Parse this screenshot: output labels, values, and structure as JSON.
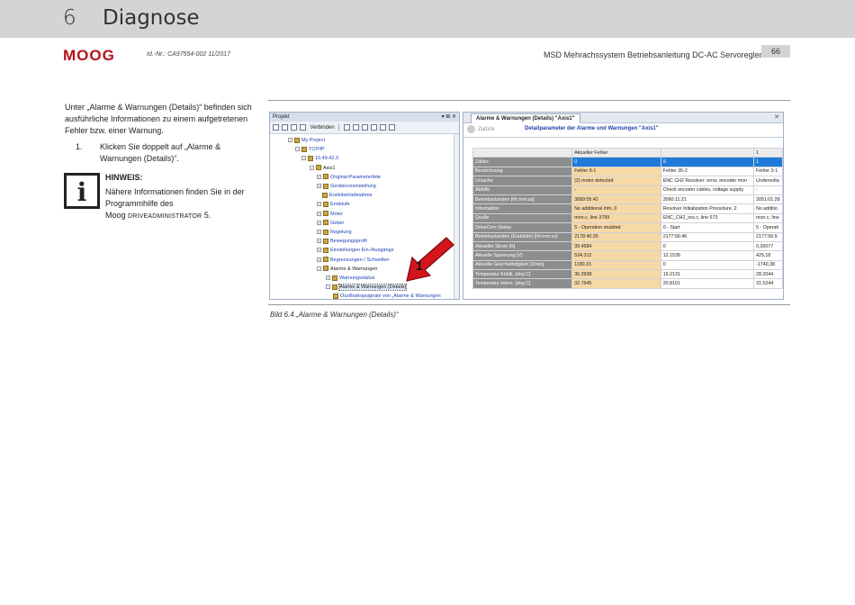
{
  "header": {
    "chapter_number": "6",
    "chapter_title": "Diagnose",
    "logo_text": "MOOG",
    "doc_id": "Id.-Nr.: CA97554-002 11/2017",
    "doc_title": "MSD Mehrachssystem Betriebsanleitung DC-AC Servoregler",
    "page_number": "66"
  },
  "body": {
    "intro": "Unter „Alarme & Warnungen (Details)“ befinden sich ausführliche Informationen zu einem aufgetretenen Fehler bzw. einer Warnung.",
    "step_number": "1.",
    "step_text": "Klicken Sie doppelt auf „Alarme & Warnungen (Details)“.",
    "note_icon": "info-icon",
    "note_glyph": "i",
    "note_heading": "HINWEIS:",
    "note_text": "Nähere Informationen finden Sie in der Programmhilfe des",
    "note_product_prefix": "Moog ",
    "note_product_name": "DriveAdministrator",
    "note_product_suffix": " 5."
  },
  "figure": {
    "caption": "Bild 6.4   „Alarme & Warnungen (Details)“",
    "callout_number": "1",
    "callout_color": "#d4151b",
    "project_panel": {
      "title": "Projekt",
      "pin_controls": "▾ ⊞ ✕",
      "connect_label": "Verbinden",
      "tree": [
        {
          "label": "My Project",
          "exp": "-"
        },
        {
          "label": "TCP/IP",
          "exp": "-"
        },
        {
          "label": "10.49.42.3",
          "exp": "-"
        },
        {
          "label": "Axis1",
          "exp": "-"
        },
        {
          "label": "Original-Parameterliste",
          "exp": "+"
        },
        {
          "label": "Gerätevoreinstellung",
          "exp": "+"
        },
        {
          "label": "Erstinbetriebnahme",
          "exp": ""
        },
        {
          "label": "Endstufe",
          "exp": "+"
        },
        {
          "label": "Motor",
          "exp": "+"
        },
        {
          "label": "Geber",
          "exp": "+"
        },
        {
          "label": "Regelung",
          "exp": "+"
        },
        {
          "label": "Bewegungsprofil",
          "exp": "+"
        },
        {
          "label": "Einstellungen Ein-/Ausgänge",
          "exp": "+"
        },
        {
          "label": "Begrenzungen / Schwellen",
          "exp": "+"
        },
        {
          "label": "Alarme & Warnungen",
          "exp": "-"
        },
        {
          "label": "Warnungsstatus",
          "exp": "+"
        },
        {
          "label": "Alarme & Warnungen (Details)",
          "exp": "-"
        },
        {
          "label": "Oszilloskopsignale von „Alarme & Warnungen",
          "exp": ""
        }
      ]
    },
    "detail_panel": {
      "tab_label": "Alarme & Warnungen (Details) \"Axis1\"",
      "back_label": "Zurück",
      "title": "Detailparameter der Alarme und Warnungen \"Axis1\"",
      "header_row": [
        "",
        "Aktueller Fehler",
        "",
        "1"
      ],
      "rows": [
        [
          "Zähler",
          "0",
          "9",
          "1"
        ],
        [
          "Bezeichnung",
          "Fehler 9-1",
          "Fehler 35-2",
          "Fehler 3-1"
        ],
        [
          "Ursache",
          "(2) motor detected",
          "ENC CH2 Resolver: error, encoder mon",
          "Undervolta"
        ],
        [
          "Abhilfe",
          "-",
          "Check encoder cables, voltage supply.",
          "-"
        ],
        [
          "Betriebsstunden [hh:mm:ss]",
          "3089:05:42",
          "3060:11:21",
          "3051:01:28"
        ],
        [
          "Information",
          "No additional Info, 0",
          "Resolver Initialization Procedure, 2",
          "No additio"
        ],
        [
          "Quelle",
          "mon.c, line 3799",
          "ENC_CH2_res.c, line 673",
          "mon.c, line"
        ],
        [
          "DriveCom Status",
          "5 - Operation enabled",
          "0 - Start",
          "5 - Operati"
        ],
        [
          "Betriebsstunden (Endstufe) [hh:mm:ss]",
          "2178:40:25",
          "2177:56:46",
          "2177:56:9"
        ],
        [
          "Aktueller Strom   [A]",
          "39.4584",
          "0",
          "0,20077"
        ],
        [
          "Aktuelle Spannung   [V]",
          "534.312",
          "12.1539",
          "425,18"
        ],
        [
          "Aktuelle Geschwindigkeit   [1/min]",
          "1180.15",
          "0",
          "-1740,38"
        ],
        [
          "Temperatur Kühlk.   [deg C]",
          "36.3938",
          "19.2131",
          "28.2044"
        ],
        [
          "Temperatur intern.   [deg C]",
          "32.7645",
          "20.8101",
          "31.5244"
        ]
      ]
    }
  }
}
